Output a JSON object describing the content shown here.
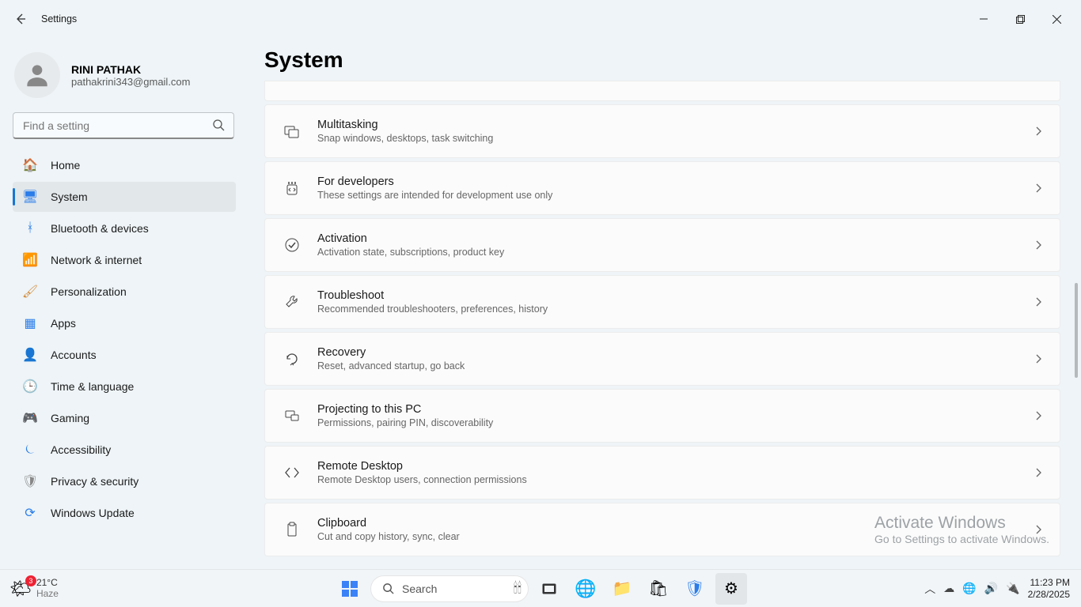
{
  "window": {
    "title": "Settings"
  },
  "profile": {
    "name": "RINI PATHAK",
    "email": "pathakrini343@gmail.com"
  },
  "search": {
    "placeholder": "Find a setting"
  },
  "nav": {
    "items": [
      {
        "label": "Home",
        "icon": "🏠",
        "color": "#e07a2e"
      },
      {
        "label": "System",
        "icon": "🖥",
        "color": "#2b7de9",
        "active": true
      },
      {
        "label": "Bluetooth & devices",
        "icon": "ᚼ",
        "color": "#2b7de9"
      },
      {
        "label": "Network & internet",
        "icon": "📶",
        "color": "#2b7de9"
      },
      {
        "label": "Personalization",
        "icon": "🖌",
        "color": "#d18b3a"
      },
      {
        "label": "Apps",
        "icon": "▦",
        "color": "#2b7de9"
      },
      {
        "label": "Accounts",
        "icon": "👤",
        "color": "#3ba55d"
      },
      {
        "label": "Time & language",
        "icon": "🕒",
        "color": "#2b7de9"
      },
      {
        "label": "Gaming",
        "icon": "🎮",
        "color": "#777"
      },
      {
        "label": "Accessibility",
        "icon": "⏾",
        "color": "#2b7de9"
      },
      {
        "label": "Privacy & security",
        "icon": "🛡",
        "color": "#888"
      },
      {
        "label": "Windows Update",
        "icon": "⟳",
        "color": "#2b7de9"
      }
    ]
  },
  "page": {
    "title": "System"
  },
  "cards": [
    {
      "title": "Multitasking",
      "sub": "Snap windows, desktops, task switching",
      "icon": "multitask"
    },
    {
      "title": "For developers",
      "sub": "These settings are intended for development use only",
      "icon": "dev"
    },
    {
      "title": "Activation",
      "sub": "Activation state, subscriptions, product key",
      "icon": "check"
    },
    {
      "title": "Troubleshoot",
      "sub": "Recommended troubleshooters, preferences, history",
      "icon": "wrench"
    },
    {
      "title": "Recovery",
      "sub": "Reset, advanced startup, go back",
      "icon": "recovery"
    },
    {
      "title": "Projecting to this PC",
      "sub": "Permissions, pairing PIN, discoverability",
      "icon": "project"
    },
    {
      "title": "Remote Desktop",
      "sub": "Remote Desktop users, connection permissions",
      "icon": "remote"
    },
    {
      "title": "Clipboard",
      "sub": "Cut and copy history, sync, clear",
      "icon": "clipboard"
    }
  ],
  "activate": {
    "l1": "Activate Windows",
    "l2": "Go to Settings to activate Windows."
  },
  "taskbar": {
    "weather": {
      "temp": "21°C",
      "desc": "Haze",
      "badge": "3"
    },
    "search": "Search",
    "time": "11:23 PM",
    "date": "2/28/2025"
  }
}
